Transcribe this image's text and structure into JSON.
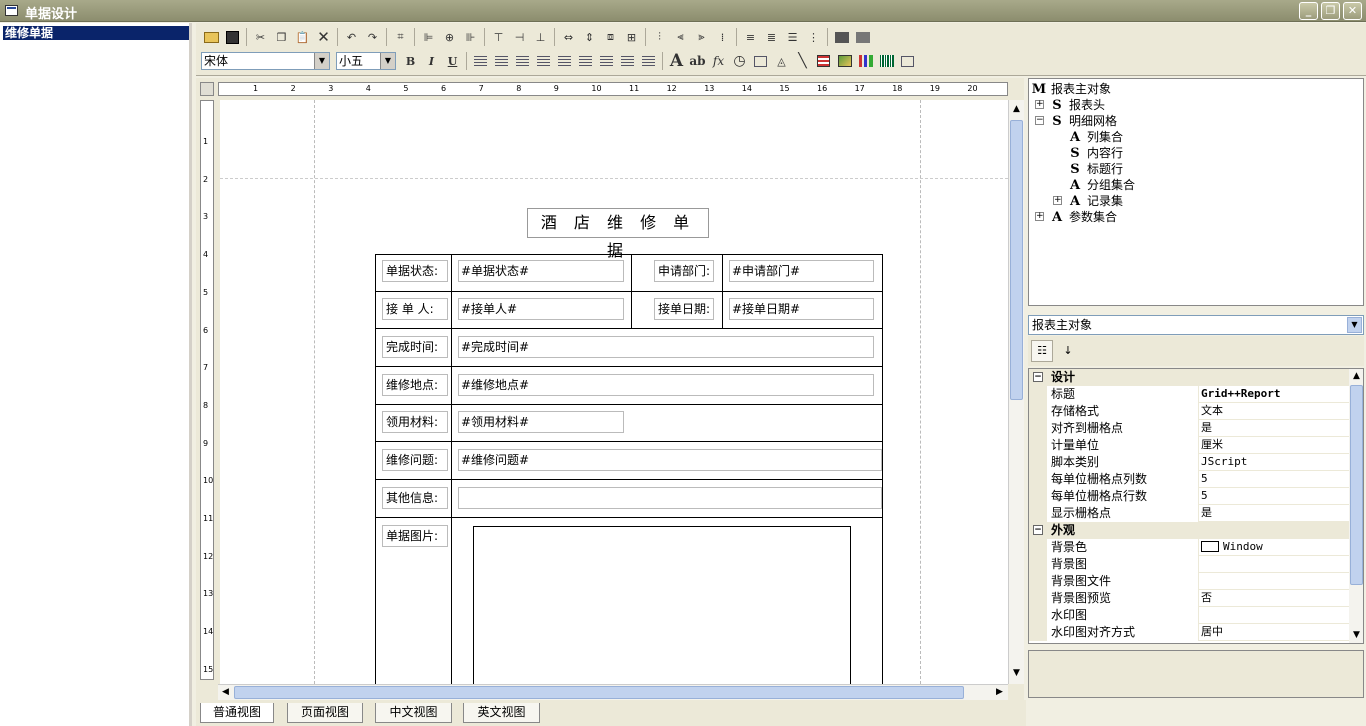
{
  "window": {
    "title": "单据设计",
    "controls": [
      "minimize-icon",
      "restore-icon",
      "close-icon"
    ]
  },
  "left_panel": {
    "items": [
      {
        "label": "维修单据",
        "selected": true
      }
    ]
  },
  "toolbar": {
    "font_name": "宋体",
    "font_size": "小五",
    "bold": "B",
    "italic": "I",
    "underline": "U",
    "text_tool": "A",
    "ab_tool": "ab",
    "fx_tool": "fx"
  },
  "ruler": {
    "horizontal": [
      "1",
      "2",
      "3",
      "4",
      "5",
      "6",
      "7",
      "8",
      "9",
      "10",
      "11",
      "12",
      "13",
      "14",
      "15",
      "16",
      "17",
      "18",
      "19",
      "20"
    ],
    "vertical": [
      "1",
      "2",
      "3",
      "4",
      "5",
      "6",
      "7",
      "8",
      "9",
      "10",
      "11",
      "12",
      "13",
      "14",
      "15"
    ]
  },
  "report": {
    "title": "酒 店 维 修 单 据",
    "rows": [
      {
        "label": "单据状态:",
        "field": "#单据状态#",
        "label2": "申请部门:",
        "field2": "#申请部门#"
      },
      {
        "label": "接 单 人:",
        "field": "#接单人#",
        "label2": "接单日期:",
        "field2": "#接单日期#"
      },
      {
        "label": "完成时间:",
        "field": "#完成时间#"
      },
      {
        "label": "维修地点:",
        "field": "#维修地点#"
      },
      {
        "label": "领用材料:",
        "field": "#领用材料#"
      },
      {
        "label": "维修问题:",
        "field": "#维修问题#"
      },
      {
        "label": "其他信息:",
        "field": ""
      },
      {
        "label": "单据图片:",
        "field": ""
      }
    ]
  },
  "tabs": [
    "普通视图",
    "页面视图",
    "中文视图",
    "英文视图"
  ],
  "tree": {
    "root": {
      "icon": "M",
      "label": "报表主对象"
    },
    "nodes": [
      {
        "icon": "S",
        "label": "报表头",
        "expandable": true
      },
      {
        "icon": "S",
        "label": "明细网格",
        "expanded": true
      },
      {
        "icon": "A",
        "label": "列集合"
      },
      {
        "icon": "S",
        "label": "内容行"
      },
      {
        "icon": "S",
        "label": "标题行"
      },
      {
        "icon": "A",
        "label": "分组集合"
      },
      {
        "icon": "A",
        "label": "记录集",
        "expandable": true
      },
      {
        "icon": "A",
        "label": "参数集合",
        "expandable": true
      }
    ]
  },
  "properties": {
    "object": "报表主对象",
    "categories": [
      {
        "name": "设计",
        "rows": [
          {
            "name": "标题",
            "value": "Grid++Report"
          },
          {
            "name": "存储格式",
            "value": "文本"
          },
          {
            "name": "对齐到栅格点",
            "value": "是"
          },
          {
            "name": "计量单位",
            "value": "厘米"
          },
          {
            "name": "脚本类别",
            "value": "JScript"
          },
          {
            "name": "每单位栅格点列数",
            "value": "5"
          },
          {
            "name": "每单位栅格点行数",
            "value": "5"
          },
          {
            "name": "显示栅格点",
            "value": "是"
          }
        ]
      },
      {
        "name": "外观",
        "rows": [
          {
            "name": "背景色",
            "value": "Window",
            "swatch": "#ffffff"
          },
          {
            "name": "背景图",
            "value": ""
          },
          {
            "name": "背景图文件",
            "value": ""
          },
          {
            "name": "背景图预览",
            "value": "否"
          },
          {
            "name": "水印图",
            "value": ""
          },
          {
            "name": "水印图对齐方式",
            "value": "居中"
          }
        ]
      }
    ]
  },
  "colors": {
    "selection": "#0a246a",
    "chrome": "#ece9d8",
    "scroll_thumb": "#c1d2ee"
  }
}
